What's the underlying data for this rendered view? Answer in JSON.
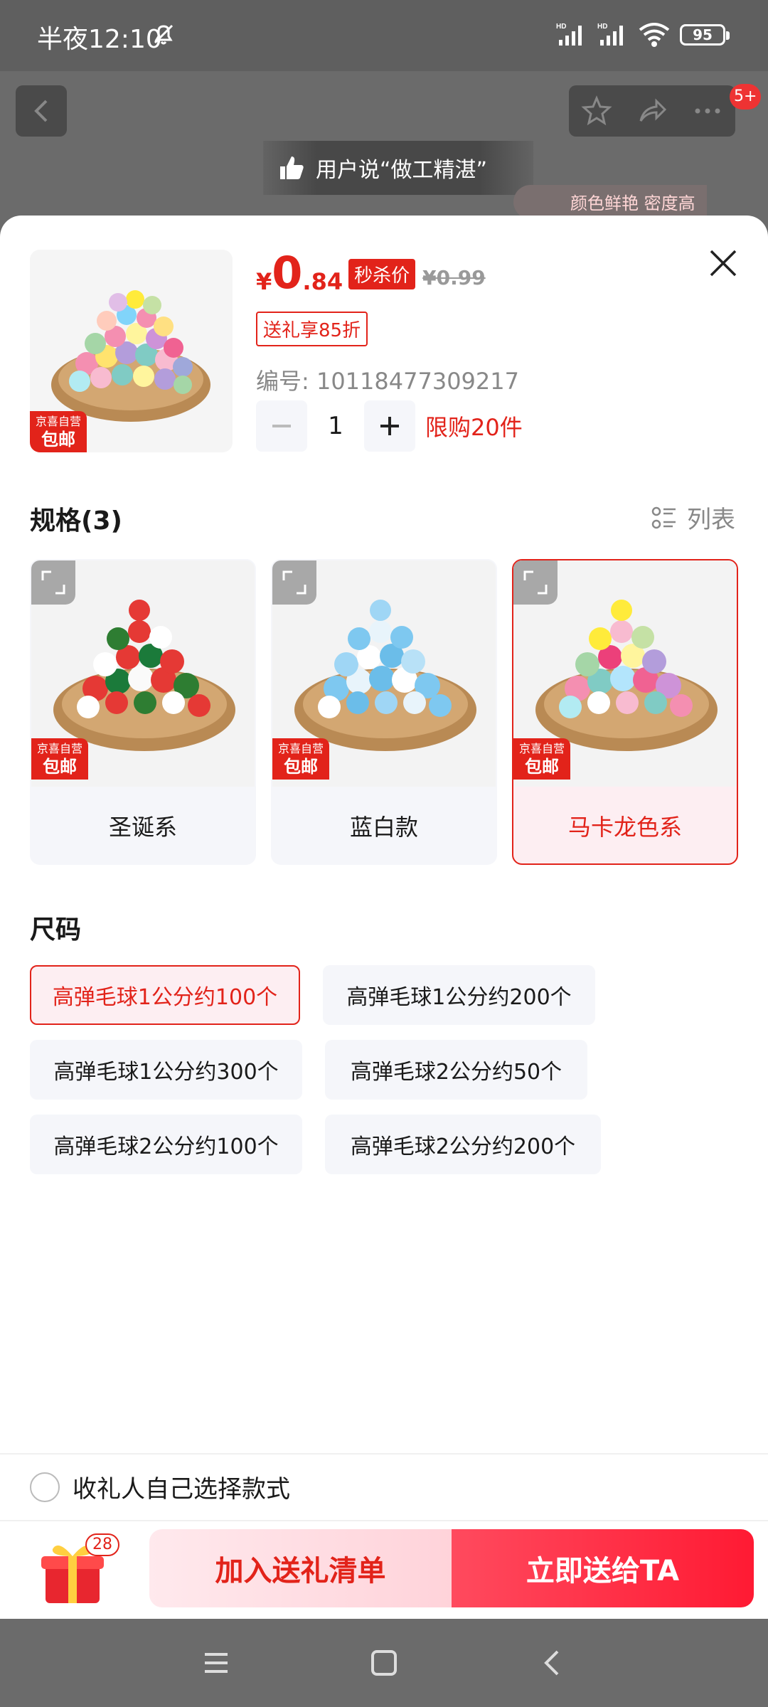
{
  "status_bar": {
    "time": "半夜12:10",
    "network_1": "HD",
    "network_2": "HD",
    "battery": "95"
  },
  "background": {
    "review_text": "用户说“做工精湛”",
    "tagline": "颜色鲜艳 密度高",
    "notification_count": "5+"
  },
  "product": {
    "currency": "¥",
    "price_int": "0",
    "price_dec": ".84",
    "seckill_label": "秒杀价",
    "original_price": "¥0.99",
    "discount_label": "送礼享85折",
    "sku_number": "编号: 10118477309217",
    "quantity": "1",
    "limit_text": "限购20件",
    "jd_tag_top": "京喜自营",
    "jd_tag_bottom": "包邮"
  },
  "spec": {
    "title": "规格(3)",
    "list_view_label": "列表",
    "options": [
      {
        "label": "圣诞系",
        "selected": false
      },
      {
        "label": "蓝白款",
        "selected": false
      },
      {
        "label": "马卡龙色系",
        "selected": true
      }
    ]
  },
  "size": {
    "title": "尺码",
    "options": [
      {
        "label": "高弹毛球1公分约100个",
        "selected": true
      },
      {
        "label": "高弹毛球1公分约200个",
        "selected": false
      },
      {
        "label": "高弹毛球1公分约300个",
        "selected": false
      },
      {
        "label": "高弹毛球2公分约50个",
        "selected": false
      },
      {
        "label": "高弹毛球2公分约100个",
        "selected": false
      },
      {
        "label": "高弹毛球2公分约200个",
        "selected": false
      }
    ]
  },
  "recipient_choice_label": "收礼人自己选择款式",
  "footer": {
    "gift_count": "28",
    "add_list_label": "加入送礼清单",
    "send_now_label": "立即送给TA"
  },
  "colors": {
    "accent": "#e2231a",
    "selected_bg": "#fdeef2",
    "chip_bg": "#f5f6fa"
  }
}
